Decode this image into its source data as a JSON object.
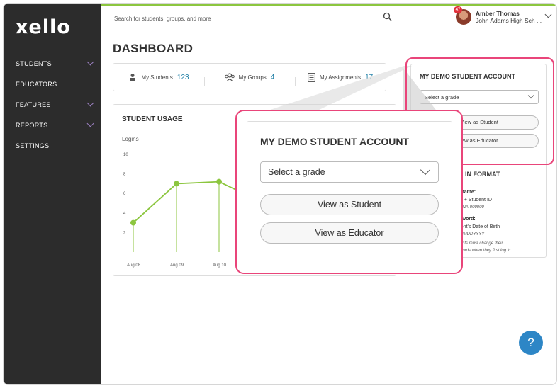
{
  "app": {
    "logo": "xello"
  },
  "sidebar": {
    "items": [
      {
        "label": "STUDENTS",
        "has_chevron": true
      },
      {
        "label": "EDUCATORS",
        "has_chevron": false
      },
      {
        "label": "FEATURES",
        "has_chevron": true
      },
      {
        "label": "REPORTS",
        "has_chevron": true
      },
      {
        "label": "SETTINGS",
        "has_chevron": false
      }
    ]
  },
  "search": {
    "placeholder": "Search for students, groups, and more"
  },
  "user": {
    "name": "Amber Thomas",
    "school": "John Adams High Sch ...",
    "notifications": "47"
  },
  "dashboard": {
    "title": "DASHBOARD"
  },
  "stats": [
    {
      "label": "My Students",
      "value": "123"
    },
    {
      "label": "My Groups",
      "value": "4"
    },
    {
      "label": "My Assignments",
      "value": "17"
    }
  ],
  "student_usage": {
    "title": "STUDENT USAGE",
    "chart_data": {
      "type": "line",
      "title": "",
      "ylabel": "Logins",
      "ylim": [
        0,
        10
      ],
      "yticks": [
        2,
        4,
        6,
        8,
        10
      ],
      "x": [
        "Aug 08",
        "Aug 09",
        "Aug 10"
      ],
      "values": [
        3,
        7,
        7.2,
        6
      ],
      "visible_x_labels": [
        "Aug 08",
        "Aug 09",
        "Aug 10"
      ]
    }
  },
  "demo_account": {
    "title": "MY DEMO STUDENT ACCOUNT",
    "select_placeholder": "Select a grade",
    "view_student": "View as Student",
    "view_educator": "View as Educator",
    "login_format": {
      "title": "LOGIN FORMAT",
      "username_label": "Username:",
      "username_value": "Prefix + Student ID",
      "username_example": "e.g. ANA-000000",
      "password_label": "Password:",
      "password_value": "Student's Date of Birth",
      "password_example": "e.g. MMDDYYYY",
      "password_note": "Students must change their passwords when they first log in."
    },
    "partial_labels": {
      "view_student": "View as Student",
      "view_educator": "iew as Educator",
      "login_title": "GN IN FORMAT",
      "username_label": "sername:",
      "username_value": "efix + Student ID",
      "username_example": "g. ANA-000000",
      "password_label": "assword:",
      "password_value": "udent's Date of Birth",
      "password_example": "g. MMDDYYYY",
      "note1": "udents must change their",
      "note2": "sswords when they first log in."
    }
  },
  "help": {
    "label": "?"
  },
  "colors": {
    "accent_green": "#8cc63f",
    "highlight_pink": "#e9457a",
    "help_blue": "#2d86c6",
    "sidebar": "#2c2c2c"
  }
}
